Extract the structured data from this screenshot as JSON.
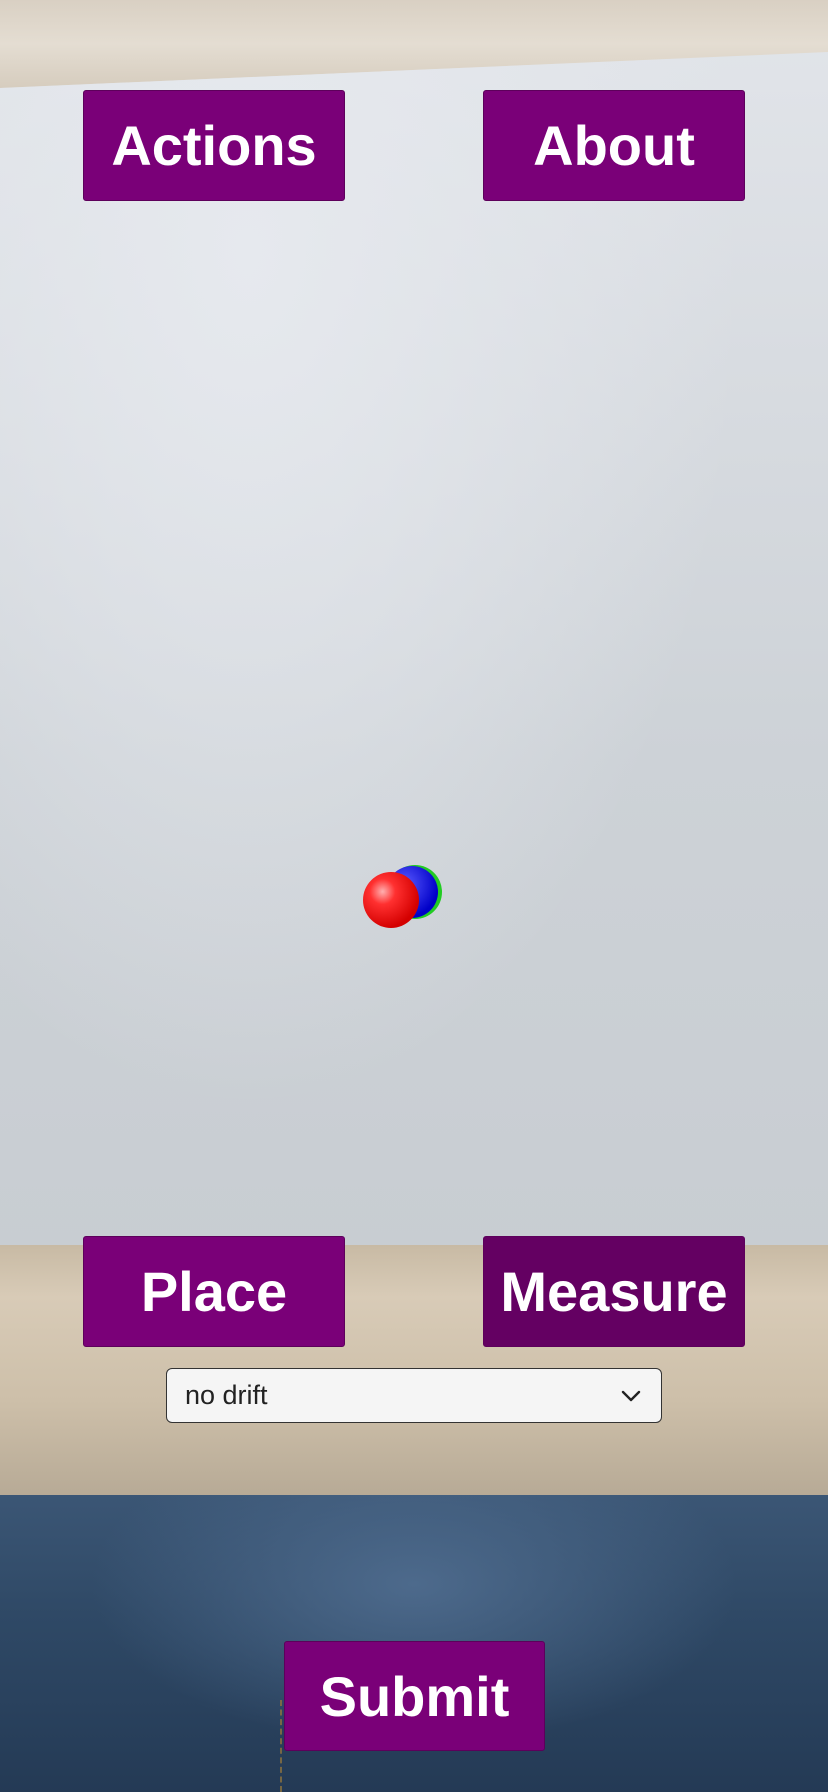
{
  "buttons": {
    "actions": "Actions",
    "about": "About",
    "place": "Place",
    "measure": "Measure",
    "submit": "Submit"
  },
  "drift_select": {
    "value": "no drift",
    "icon": "chevron-down-icon"
  },
  "colors": {
    "button_bg": "#7a0078",
    "button_bg_pressed": "#640062",
    "button_text": "#ffffff",
    "sphere_red": "#ff2a2a",
    "sphere_blue": "#1a1aff",
    "sphere_green": "#22cc22"
  }
}
